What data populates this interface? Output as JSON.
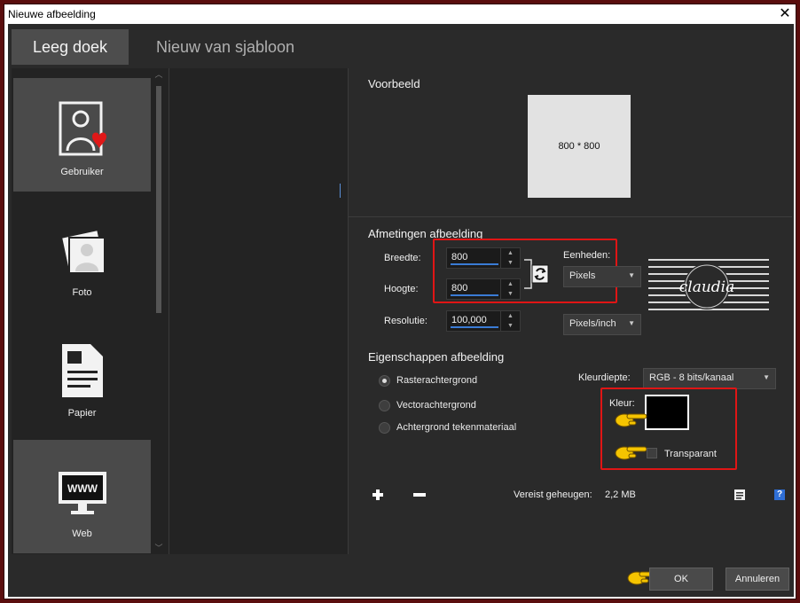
{
  "window": {
    "title": "Nieuwe afbeelding"
  },
  "tabs": [
    {
      "label": "Leeg doek"
    },
    {
      "label": "Nieuw van sjabloon"
    }
  ],
  "categories": [
    {
      "label": "Gebruiker",
      "icon": "user-heart-icon"
    },
    {
      "label": "Foto",
      "icon": "photo-stack-icon"
    },
    {
      "label": "Papier",
      "icon": "document-icon"
    },
    {
      "label": "Web",
      "icon": "www-monitor-icon"
    }
  ],
  "preview": {
    "title": "Voorbeeld",
    "size_text": "800 * 800"
  },
  "dimensions": {
    "title": "Afmetingen afbeelding",
    "width_label": "Breedte:",
    "width_value": "800",
    "height_label": "Hoogte:",
    "height_value": "800",
    "resolution_label": "Resolutie:",
    "resolution_value": "100,000",
    "units_label": "Eenheden:",
    "units_value": "Pixels",
    "resolution_units_value": "Pixels/inch",
    "watermark_text": "claudia"
  },
  "properties": {
    "title": "Eigenschappen afbeelding",
    "options": [
      {
        "label": "Rasterachtergrond",
        "selected": true
      },
      {
        "label": "Vectorachtergrond",
        "selected": false
      },
      {
        "label": "Achtergrond tekenmateriaal",
        "selected": false
      }
    ],
    "color_depth_label": "Kleurdiepte:",
    "color_depth_value": "RGB - 8 bits/kanaal",
    "color_label": "Kleur:",
    "color_value": "#000000",
    "transparent_label": "Transparant",
    "transparent_checked": false
  },
  "memory": {
    "label": "Vereist geheugen:",
    "value": "2,2 MB"
  },
  "footer": {
    "ok_label": "OK",
    "cancel_label": "Annuleren"
  },
  "colors": {
    "accent": "#3a7bd5",
    "highlight": "#e01515",
    "pointer": "#f5c400"
  }
}
